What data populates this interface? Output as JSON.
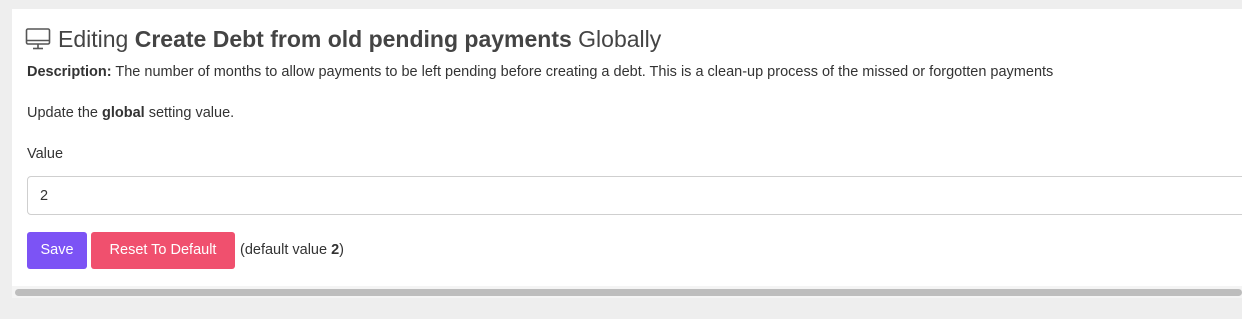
{
  "header": {
    "prefix": "Editing",
    "setting_name": "Create Debt from old pending payments",
    "suffix": "Globally",
    "icon": "monitor-icon"
  },
  "description": {
    "label": "Description:",
    "text": "The number of months to allow payments to be left pending before creating a debt. This is a clean-up process of the missed or forgotten payments"
  },
  "update_note": {
    "before": "Update the",
    "bold": "global",
    "after": "setting value."
  },
  "form": {
    "value_label": "Value",
    "value": "2"
  },
  "actions": {
    "save_label": "Save",
    "reset_label": "Reset To Default",
    "default_prefix": "(default value",
    "default_value": "2",
    "default_suffix": ")"
  },
  "colors": {
    "save": "#7c53f5",
    "reset": "#f0506e",
    "background": "#eeeeee"
  }
}
